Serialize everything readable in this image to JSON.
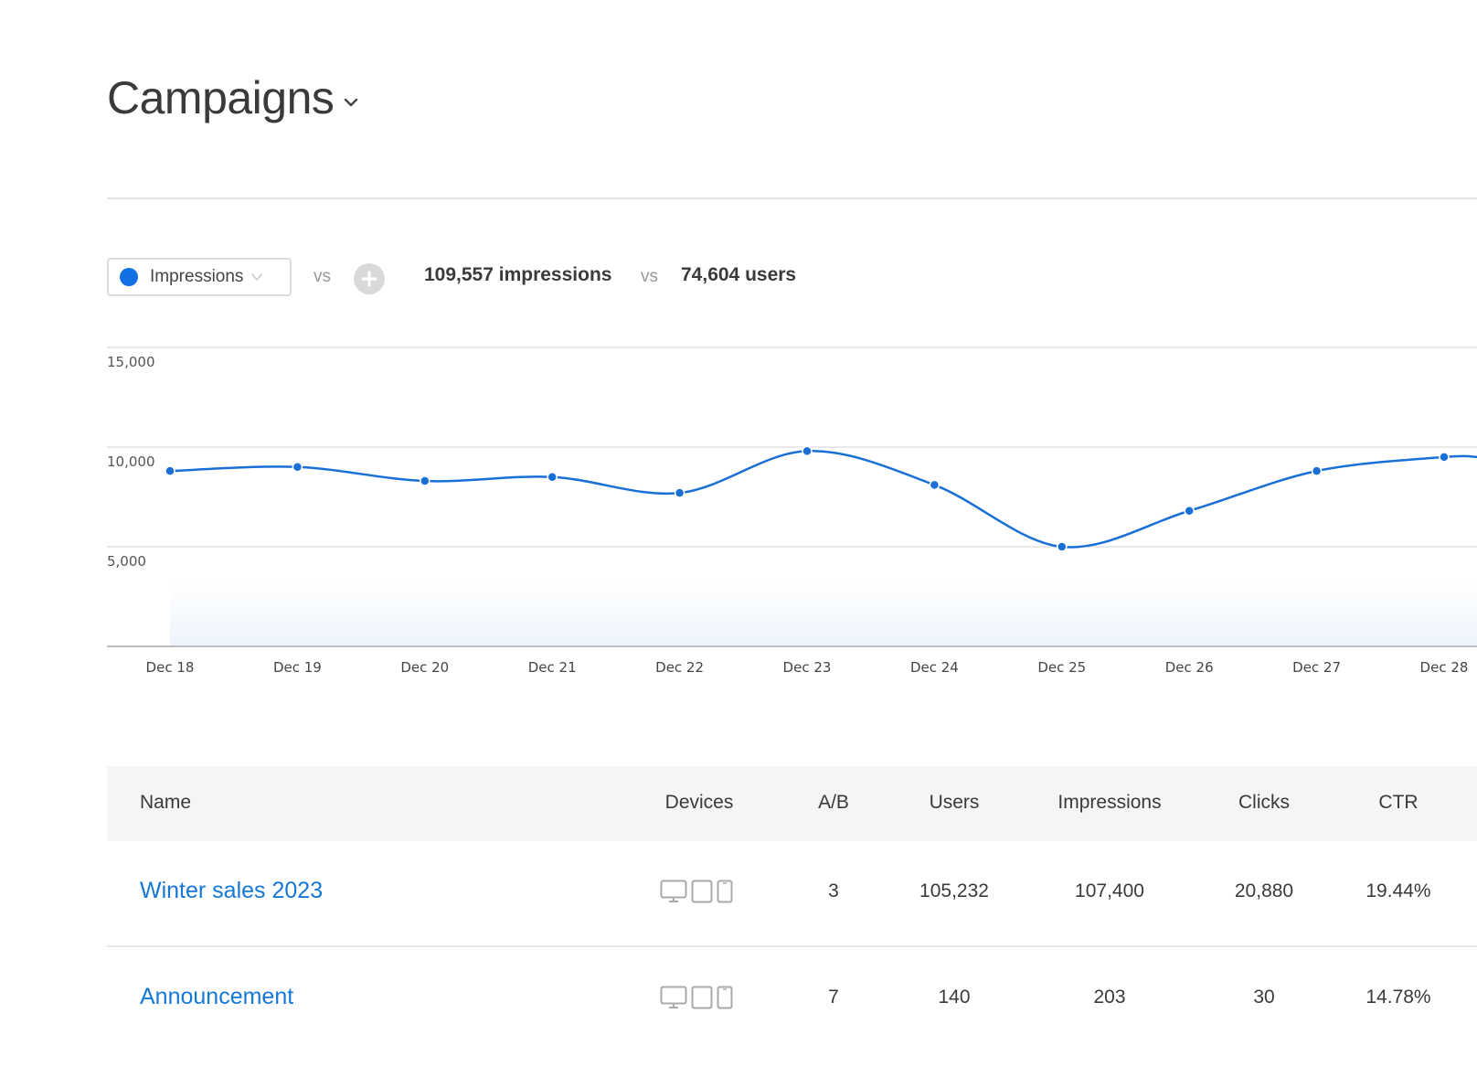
{
  "page": {
    "title": "Campaigns"
  },
  "toolbar": {
    "metric_label": "Impressions",
    "vs_label": "vs",
    "summary_impressions": "109,557 impressions",
    "summary_vs": "vs",
    "summary_users": "74,604 users",
    "colors": {
      "accent": "#1170e4"
    }
  },
  "chart_data": {
    "type": "line",
    "x": [
      "Dec 18",
      "Dec 19",
      "Dec 20",
      "Dec 21",
      "Dec 22",
      "Dec 23",
      "Dec 24",
      "Dec 25",
      "Dec 26",
      "Dec 27",
      "Dec 28"
    ],
    "series": [
      {
        "values": [
          8800,
          9000,
          8300,
          8500,
          7700,
          9800,
          8100,
          5000,
          6800,
          8800,
          9500
        ]
      }
    ],
    "yticks": [
      "5,000",
      "10,000",
      "15,000"
    ],
    "ylim": [
      0,
      15000
    ],
    "grid": true,
    "line_color": "#1a6fd6"
  },
  "table": {
    "columns": [
      "Name",
      "Devices",
      "A/B",
      "Users",
      "Impressions",
      "Clicks",
      "CTR"
    ],
    "rows": [
      {
        "name": "Winter sales 2023",
        "ab": "3",
        "users": "105,232",
        "impressions": "107,400",
        "clicks": "20,880",
        "ctr": "19.44%"
      },
      {
        "name": "Announcement",
        "ab": "7",
        "users": "140",
        "impressions": "203",
        "clicks": "30",
        "ctr": "14.78%"
      }
    ]
  }
}
